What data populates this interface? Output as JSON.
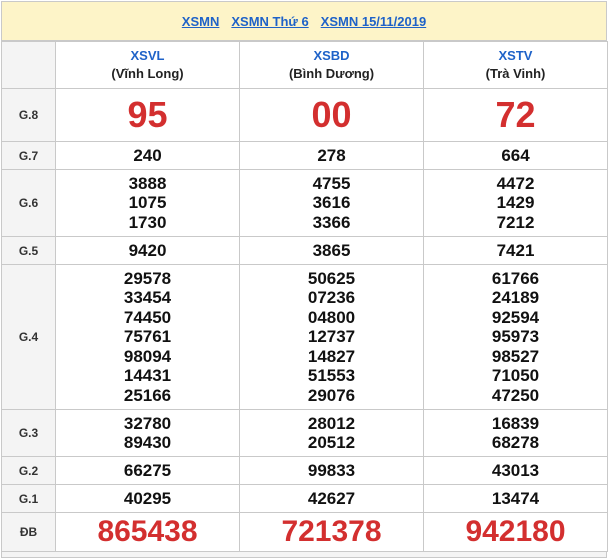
{
  "header": {
    "link1": "XSMN",
    "link2": "XSMN Thứ 6",
    "link3": "XSMN 15/11/2019"
  },
  "provinces": [
    {
      "code": "XSVL",
      "name": "(Vĩnh Long)"
    },
    {
      "code": "XSBD",
      "name": "(Bình Dương)"
    },
    {
      "code": "XSTV",
      "name": "(Trà Vinh)"
    }
  ],
  "prizes": {
    "g8": {
      "label": "G.8",
      "values": [
        "95",
        "00",
        "72"
      ]
    },
    "g7": {
      "label": "G.7",
      "values": [
        "240",
        "278",
        "664"
      ]
    },
    "g6": {
      "label": "G.6",
      "values": [
        [
          "3888",
          "1075",
          "1730"
        ],
        [
          "4755",
          "3616",
          "3366"
        ],
        [
          "4472",
          "1429",
          "7212"
        ]
      ]
    },
    "g5": {
      "label": "G.5",
      "values": [
        "9420",
        "3865",
        "7421"
      ]
    },
    "g4": {
      "label": "G.4",
      "values": [
        [
          "29578",
          "33454",
          "74450",
          "75761",
          "98094",
          "14431",
          "25166"
        ],
        [
          "50625",
          "07236",
          "04800",
          "12737",
          "14827",
          "51553",
          "29076"
        ],
        [
          "61766",
          "24189",
          "92594",
          "95973",
          "98527",
          "71050",
          "47250"
        ]
      ]
    },
    "g3": {
      "label": "G.3",
      "values": [
        [
          "32780",
          "89430"
        ],
        [
          "28012",
          "20512"
        ],
        [
          "16839",
          "68278"
        ]
      ]
    },
    "g2": {
      "label": "G.2",
      "values": [
        "66275",
        "99833",
        "43013"
      ]
    },
    "g1": {
      "label": "G.1",
      "values": [
        "40295",
        "42627",
        "13474"
      ]
    },
    "db": {
      "label": "ĐB",
      "values": [
        "865438",
        "721378",
        "942180"
      ]
    }
  },
  "colors": {
    "link": "#1e62c8",
    "highlight": "#d32f2f",
    "header_bg": "#fdf4c8"
  }
}
